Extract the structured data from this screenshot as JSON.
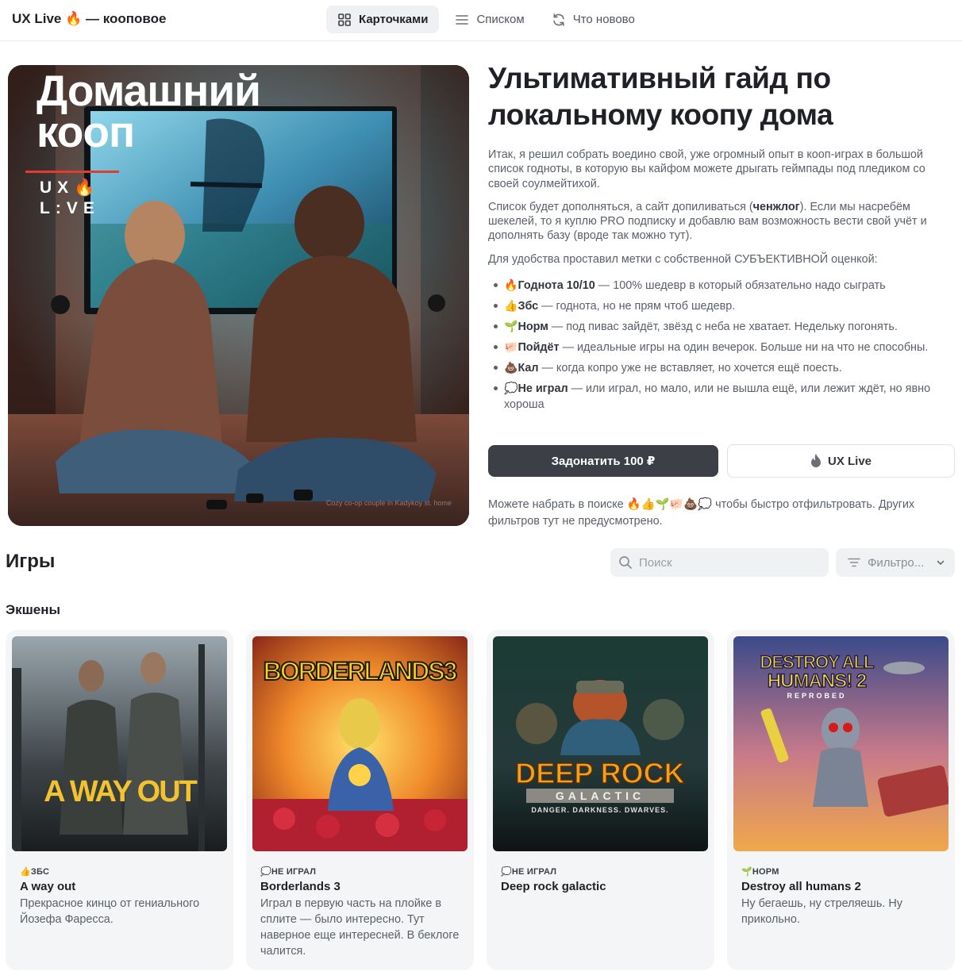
{
  "header": {
    "brand": "UX Live 🔥 — кооповое",
    "nav": [
      {
        "label": "Карточками",
        "icon": "grid-icon",
        "active": true
      },
      {
        "label": "Списком",
        "icon": "list-icon",
        "active": false
      },
      {
        "label": "Что новово",
        "icon": "refresh-icon",
        "active": false
      }
    ]
  },
  "hero": {
    "title_line1": "Домашний",
    "title_line2": "кооп",
    "logo_line1": "UX🔥",
    "logo_line2": "L:VE",
    "caption": "Cozy co-op couple in Kadykoy st. home"
  },
  "intro": {
    "title": "Ультимативный гайд по локальному коопу дома",
    "p1": "Итак, я решил собрать воедино свой, уже огромный опыт в кооп-играх в большой список годноты, в которую вы кайфом можете дрыгать геймпады под пледиком со своей соулмейтихой.",
    "p2_before": "Список будет дополняться, а сайт допиливаться (",
    "p2_bold": "ченжлог",
    "p2_after": "). Если мы насребём шекелей, то я куплю PRO подписку и добавлю вам возможность вести свой учёт и дополнять базу (вроде так можно тут).",
    "p3": "Для удобства проставил метки с собственной СУБЪЕКТИВНОЙ оценкой:",
    "labels": [
      {
        "emoji": "🔥",
        "name": "Годнота 10/10",
        "text": " — 100% шедевр в который обязательно надо сыграть"
      },
      {
        "emoji": "👍",
        "name": "Збс",
        "text": " — годнота, но не прям чтоб шедевр."
      },
      {
        "emoji": "🌱",
        "name": "Норм",
        "text": " — под пивас зайдёт, звёзд с неба не хватает. Недельку погонять."
      },
      {
        "emoji": "🐖",
        "name": "Пойдёт",
        "text": " — идеальные игры на один вечерок. Больше ни на что не способны."
      },
      {
        "emoji": "💩",
        "name": "Кал",
        "text": " — когда копро уже не вставляет, но хочется ещё поесть."
      },
      {
        "emoji": "💭",
        "name": "Не играл",
        "text": " — или играл, но мало, или не вышла ещё, или лежит ждёт, но явно хороша"
      }
    ]
  },
  "buttons": {
    "donate": "Задонатить 100 ₽",
    "uxlive": "UX Live"
  },
  "hint": "Можете набрать в поиске 🔥👍🌱🐖💩💭 чтобы быстро отфильтровать. Других фильтров тут не предусмотрено.",
  "games": {
    "heading": "Игры",
    "search_placeholder": "Поиск",
    "filter_label": "Фильтро...",
    "section": "Экшены",
    "cards": [
      {
        "tag": "👍ЗБС",
        "title": "A way out",
        "desc": "Прекрасное кинцо от гениального Йозефа Фаресса.",
        "cover_text": "A WAY OUT"
      },
      {
        "tag": "💭НЕ ИГРАЛ",
        "title": "Borderlands 3",
        "desc": "Играл в первую часть на плойке в сплите — было интересно. Тут наверное еще интересней. В беклоге чалится.",
        "cover_text": "BORDERLANDS3"
      },
      {
        "tag": "💭НЕ ИГРАЛ",
        "title": "Deep rock galactic",
        "desc": "",
        "cover_text": "DEEP ROCK",
        "cover_sub": "GALACTIC",
        "cover_tagline": "DANGER. DARKNESS. DWARVES."
      },
      {
        "tag": "🌱НОРМ",
        "title": "Destroy all humans 2",
        "desc": "Ну бегаешь, ну стреляешь. Ну прикольно.",
        "cover_text": "DESTROY ALL",
        "cover_text2": "HUMANS! 2",
        "cover_sub": "REPROBED"
      }
    ]
  },
  "colors": {
    "accent_dark": "#3c3f46",
    "logo_red": "#e53a2f",
    "card_bg": "#f4f5f6"
  }
}
